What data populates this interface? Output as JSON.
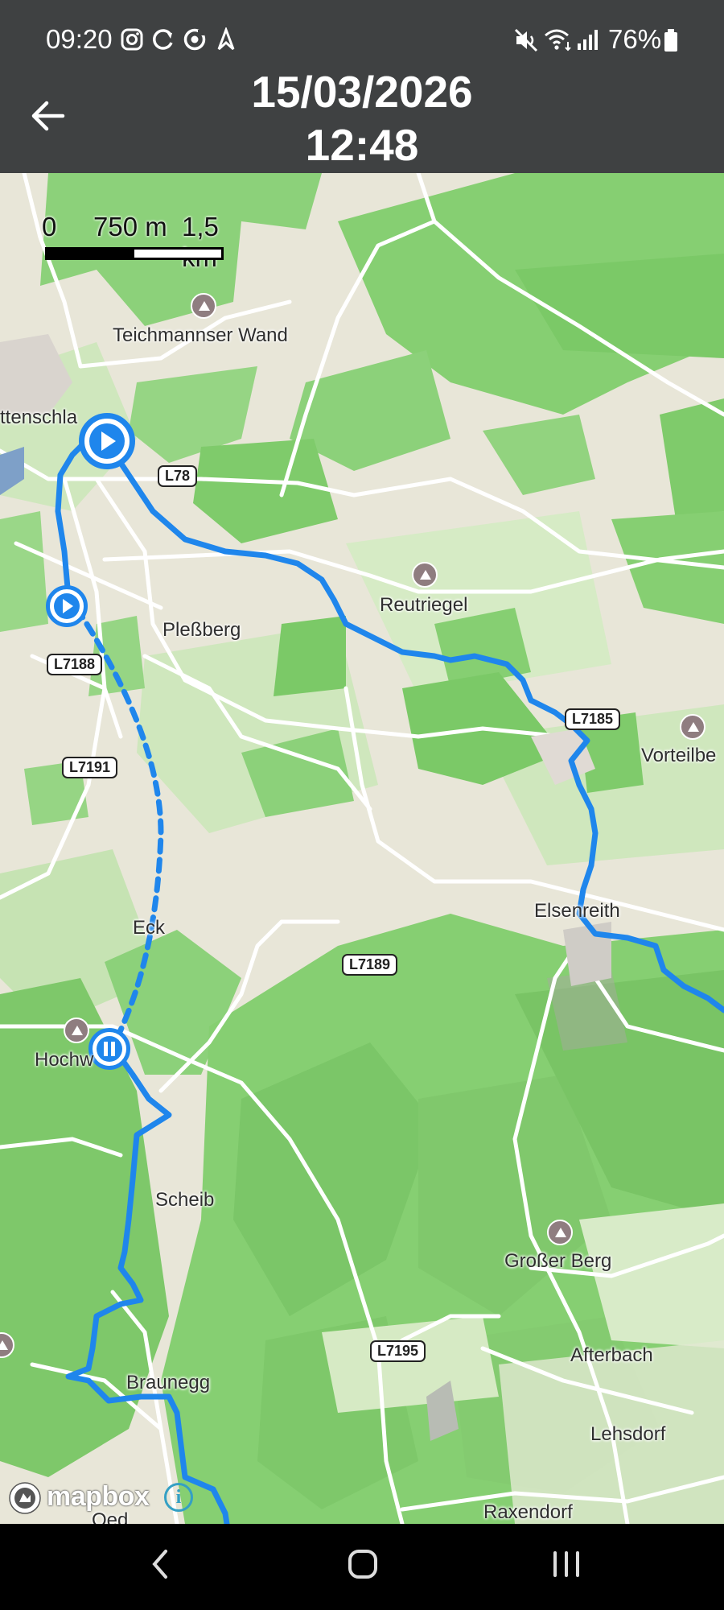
{
  "status_bar": {
    "time": "09:20",
    "battery": "76%",
    "left_icons": [
      "instagram-icon",
      "sync-icon",
      "target-icon",
      "navigation-arrow-icon"
    ],
    "right_icons": [
      "mute-icon",
      "wifi-icon",
      "signal-icon",
      "battery-icon"
    ]
  },
  "header": {
    "date": "15/03/2026",
    "time": "12:48",
    "back_icon": "back-arrow-icon"
  },
  "map": {
    "scale": {
      "labels": [
        "0",
        "750 m",
        "1,5 km"
      ]
    },
    "places": {
      "teichmannser_wand": "Teichmannser Wand",
      "ottenschlag": "ttenschla",
      "plessberg": "Pleßberg",
      "reutriegel": "Reutriegel",
      "vorteilberg": "Vorteilbe",
      "eck": "Eck",
      "elsenreith": "Elsenreith",
      "hochwald": "Hochw",
      "scheib": "Scheib",
      "grosser_berg": "Großer Berg",
      "afterbach": "Afterbach",
      "braunegg": "Braunegg",
      "lehsdorf": "Lehsdorf",
      "raxendorf": "Raxendorf",
      "oed": "Oed"
    },
    "roads": {
      "l78": "L78",
      "l7188": "L7188",
      "l7191": "L7191",
      "l7185": "L7185",
      "l7189": "L7189",
      "l7195": "L7195"
    },
    "attribution": "mapbox",
    "info_icon": "i",
    "route_color": "#1f86ec"
  },
  "nav_bar": {
    "icons": [
      "nav-back-icon",
      "nav-home-icon",
      "nav-recents-icon"
    ]
  }
}
